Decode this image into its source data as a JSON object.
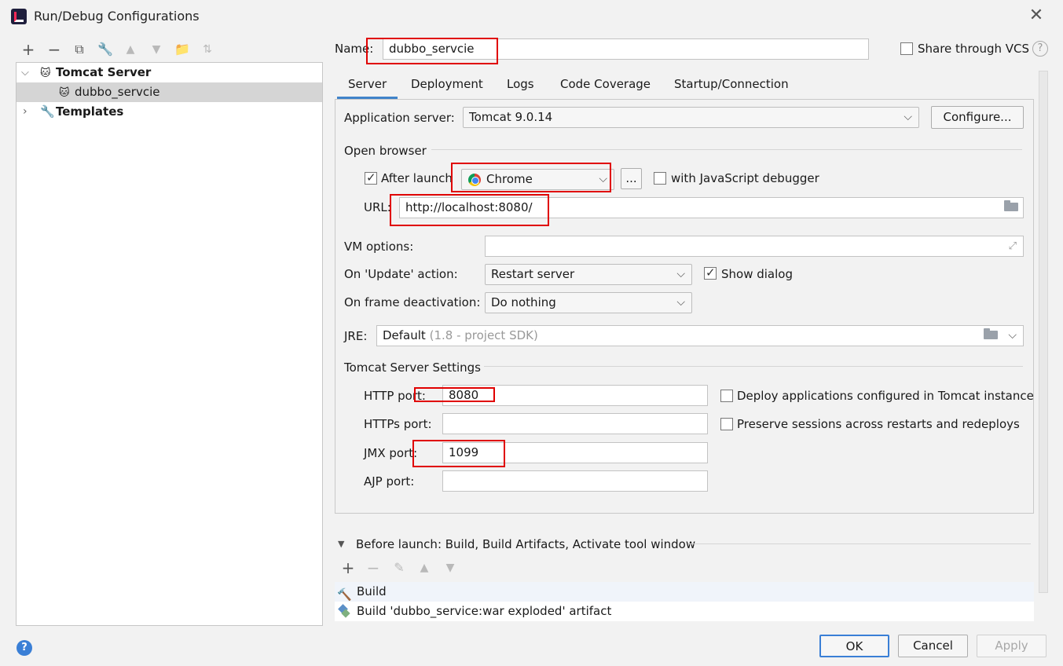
{
  "window": {
    "title": "Run/Debug Configurations"
  },
  "left_toolbar": {
    "icons": [
      "add-icon",
      "remove-icon",
      "copy-icon",
      "wrench-icon",
      "move-up-icon",
      "move-down-icon",
      "new-folder-icon",
      "sort-icon"
    ]
  },
  "tree": {
    "group_label": "Tomcat Server",
    "child_label": "dubbo_servcie",
    "templates_label": "Templates"
  },
  "name_field": {
    "label": "Name:",
    "value": "dubbo_servcie"
  },
  "share": {
    "label": "Share through VCS",
    "checked": false
  },
  "tabs": [
    "Server",
    "Deployment",
    "Logs",
    "Code Coverage",
    "Startup/Connection"
  ],
  "server": {
    "app_server_label": "Application server:",
    "app_server_value": "Tomcat 9.0.14",
    "configure_label": "Configure...",
    "open_browser_label": "Open browser",
    "after_launch_label": "After launch",
    "after_launch_checked": true,
    "browser_value": "Chrome",
    "ellipsis_label": "...",
    "js_debugger_label": "with JavaScript debugger",
    "url_label": "URL:",
    "url_value": "http://localhost:8080/",
    "vm_options_label": "VM options:",
    "vm_options_value": "",
    "update_action_label": "On 'Update' action:",
    "update_action_value": "Restart server",
    "show_dialog_label": "Show dialog",
    "show_dialog_checked": true,
    "frame_deactivation_label": "On frame deactivation:",
    "frame_deactivation_value": "Do nothing",
    "jre_label": "JRE:",
    "jre_value": "Default",
    "jre_hint": "(1.8 - project SDK)",
    "tomcat_settings_label": "Tomcat Server Settings",
    "http_port_label": "HTTP port:",
    "http_port_value": "8080",
    "https_port_label": "HTTPs port:",
    "https_port_value": "",
    "jmx_port_label": "JMX port:",
    "jmx_port_value": "1099",
    "ajp_port_label": "AJP port:",
    "ajp_port_value": "",
    "deploy_label": "Deploy applications configured in Tomcat instance",
    "preserve_label": "Preserve sessions across restarts and redeploys"
  },
  "before_launch": {
    "header": "Before launch: Build, Build Artifacts, Activate tool window",
    "items": [
      "Build",
      "Build 'dubbo_service:war exploded' artifact"
    ]
  },
  "footer": {
    "ok": "OK",
    "cancel": "Cancel",
    "apply": "Apply"
  }
}
